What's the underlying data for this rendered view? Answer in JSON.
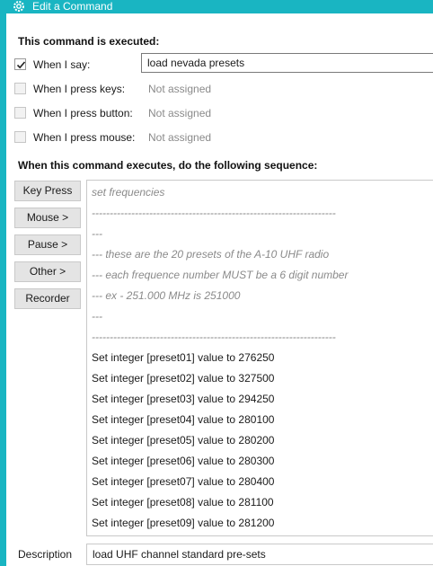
{
  "window": {
    "title": "Edit a Command",
    "title_icon": "gear-icon",
    "accent_color": "#19b5c2"
  },
  "triggers": {
    "heading": "This command is executed:",
    "when_i_say": {
      "label": "When I say:",
      "checked": true,
      "value": "load nevada presets"
    },
    "when_i_press_keys": {
      "label": "When I press keys:",
      "checked": false,
      "value": "Not assigned"
    },
    "when_i_press_button": {
      "label": "When I press button:",
      "checked": false,
      "value": "Not assigned"
    },
    "when_i_press_mouse": {
      "label": "When I press mouse:",
      "checked": false,
      "value": "Not assigned"
    }
  },
  "sequence": {
    "heading": "When this command executes, do the following sequence:",
    "buttons": {
      "key_press": "Key Press",
      "mouse": "Mouse >",
      "pause": "Pause >",
      "other": "Other >",
      "recorder": "Recorder"
    },
    "items": [
      {
        "text": "set frequencies",
        "kind": "comment"
      },
      {
        "text": "--------------------------------------------------------------------",
        "kind": "comment"
      },
      {
        "text": "---",
        "kind": "comment"
      },
      {
        "text": "---  these are the 20 presets of the A-10 UHF radio",
        "kind": "comment"
      },
      {
        "text": "--- each frequence number MUST be a 6 digit number",
        "kind": "comment"
      },
      {
        "text": "---  ex - 251.000 MHz  is 251000",
        "kind": "comment"
      },
      {
        "text": "---",
        "kind": "comment"
      },
      {
        "text": "--------------------------------------------------------------------",
        "kind": "comment"
      },
      {
        "text": "Set integer [preset01] value to 276250",
        "kind": "action"
      },
      {
        "text": "Set integer [preset02] value to 327500",
        "kind": "action"
      },
      {
        "text": "Set integer [preset03] value to 294250",
        "kind": "action"
      },
      {
        "text": "Set integer [preset04] value to 280100",
        "kind": "action"
      },
      {
        "text": "Set integer [preset05] value to 280200",
        "kind": "action"
      },
      {
        "text": "Set integer [preset06] value to 280300",
        "kind": "action"
      },
      {
        "text": "Set integer [preset07] value to 280400",
        "kind": "action"
      },
      {
        "text": "Set integer [preset08] value to 281100",
        "kind": "action"
      },
      {
        "text": "Set integer [preset09] value to 281200",
        "kind": "action"
      }
    ]
  },
  "description": {
    "label": "Description",
    "value": "load UHF channel standard pre-sets"
  }
}
